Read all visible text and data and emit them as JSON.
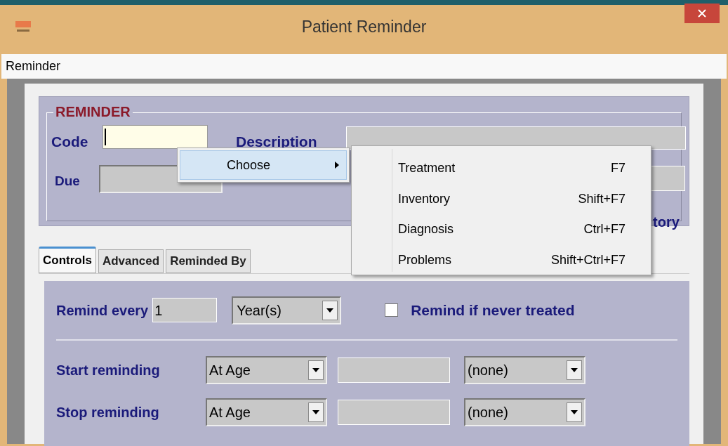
{
  "window": {
    "title": "Patient Reminder"
  },
  "menu_bar": [
    "Reminder"
  ],
  "reminder_group": {
    "legend": "REMINDER",
    "code_label": "Code",
    "description_label": "Description",
    "due_label": "Due",
    "partial_label": "tory"
  },
  "context_menu": {
    "items": [
      {
        "label": "Choose",
        "selected": true
      }
    ]
  },
  "submenu": {
    "items": [
      {
        "label": "Treatment",
        "shortcut": "F7"
      },
      {
        "label": "Inventory",
        "shortcut": "Shift+F7"
      },
      {
        "label": "Diagnosis",
        "shortcut": "Ctrl+F7"
      },
      {
        "label": "Problems",
        "shortcut": "Shift+Ctrl+F7"
      }
    ]
  },
  "tabs": [
    {
      "label": "Controls",
      "selected": true
    },
    {
      "label": "Advanced",
      "selected": false
    },
    {
      "label": "Reminded By",
      "selected": false
    }
  ],
  "controls": {
    "remind_every": {
      "label": "Remind every",
      "value": "1",
      "unit": "Year(s)"
    },
    "never_treated": {
      "label": "Remind if never treated",
      "checked": false
    },
    "rows": [
      {
        "label": "Start reminding",
        "mode": "At Age",
        "unit": "(none)"
      },
      {
        "label": "Stop reminding",
        "mode": "At Age",
        "unit": "(none)"
      }
    ]
  }
}
